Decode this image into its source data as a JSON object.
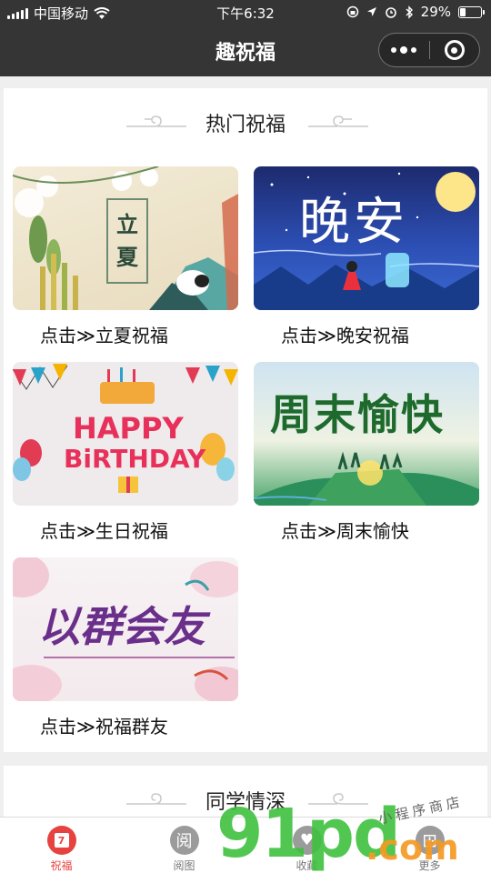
{
  "status_bar": {
    "carrier": "中国移动",
    "time": "下午6:32",
    "battery_percent": "29%",
    "battery_level": 0.29
  },
  "nav": {
    "title": "趣祝福"
  },
  "section_hot": {
    "title": "热门祝福",
    "items": [
      {
        "label": "点击≫立夏祝福",
        "image_text": "立夏",
        "image": "lixia"
      },
      {
        "label": "点击≫晚安祝福",
        "image_text": "晚安",
        "image": "wanan"
      },
      {
        "label": "点击≫生日祝福",
        "image_text_1": "HAPPY",
        "image_text_2": "BiRTHDAY",
        "image": "birthday"
      },
      {
        "label": "点击≫周末愉快",
        "image_text": "周末愉快",
        "image": "zhoumo"
      },
      {
        "label": "点击≫祝福群友",
        "image_text": "以群会友",
        "image": "qunyou"
      }
    ]
  },
  "section_classmates": {
    "title": "同学情深"
  },
  "tab_bar": {
    "tabs": [
      {
        "label": "祝福",
        "icon": "calendar-icon",
        "icon_text": "7",
        "active": true,
        "color": "#e64340"
      },
      {
        "label": "阅图",
        "icon": "read-icon",
        "icon_text": "阅",
        "active": false,
        "color": "#9b9b9b"
      },
      {
        "label": "收藏",
        "icon": "favorite-icon",
        "icon_text": "♥",
        "active": false,
        "color": "#9b9b9b"
      },
      {
        "label": "更多",
        "icon": "more-icon",
        "icon_text": "⊞",
        "active": false,
        "color": "#9b9b9b"
      }
    ]
  },
  "watermark": {
    "logo_text": "91pd",
    "suffix": ".com",
    "script_text": "小程序商店"
  },
  "colors": {
    "header_bg": "#353535",
    "accent": "#e64340",
    "watermark_green": "#3fc13f",
    "watermark_orange": "#f59a23"
  }
}
